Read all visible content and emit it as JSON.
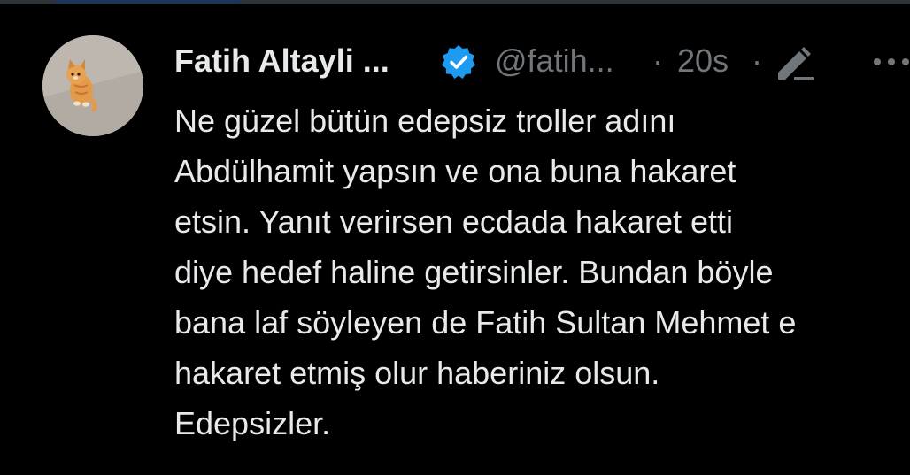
{
  "tweet": {
    "author_name": "Fatih Altayli ...",
    "handle": "@fatih...",
    "separator": "·",
    "timestamp": "20s",
    "lines": [
      "Ne güzel bütün edepsiz troller adını",
      "Abdülhamit yapsın ve ona buna hakaret",
      "etsin. Yanıt verirsen ecdada hakaret etti",
      "diye hedef haline getirsinler. Bundan böyle",
      "bana laf söyleyen de Fatih Sultan Mehmet e",
      "hakaret etmiş olur haberiniz olsun.",
      "Edepsizler."
    ]
  },
  "icons": {
    "verified": "verified-badge-icon",
    "edit": "edit-pencil-icon",
    "more": "more-options-icon"
  },
  "colors": {
    "background": "#000000",
    "text": "#e7e9ea",
    "muted": "#71767b",
    "verified_blue": "#1d9bf0"
  }
}
